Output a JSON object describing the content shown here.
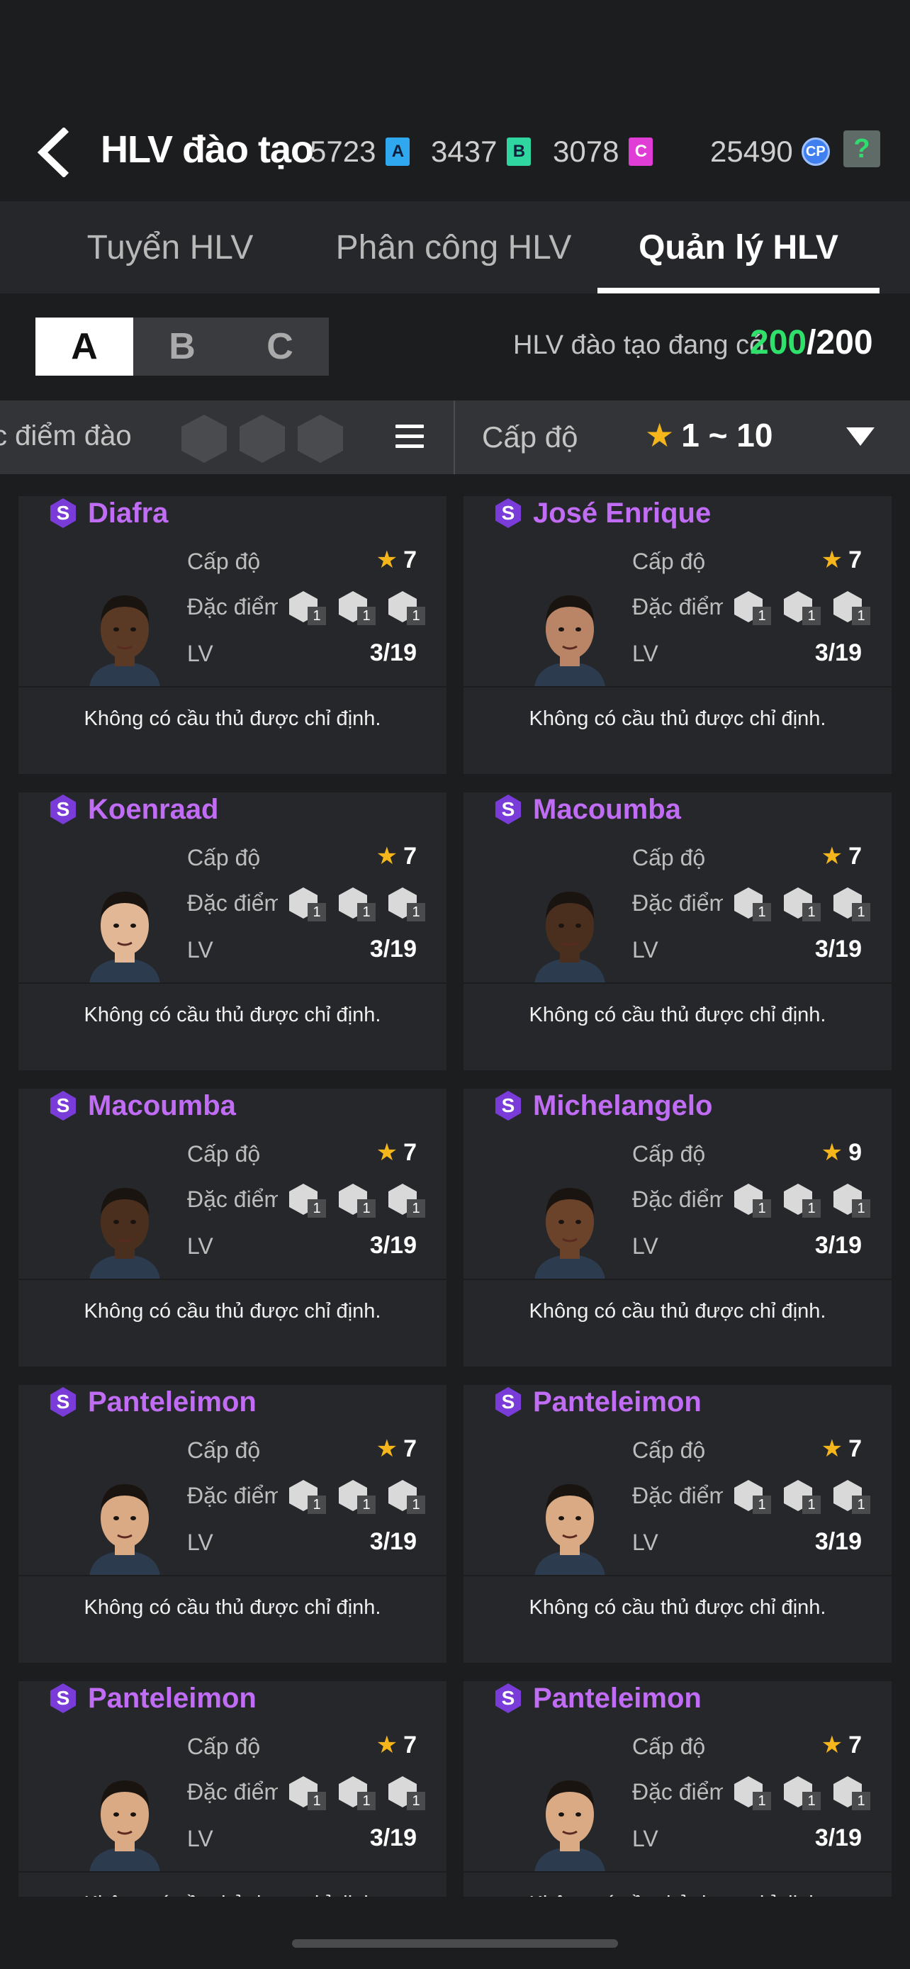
{
  "header": {
    "title": "HLV đào tạo",
    "currencies": [
      {
        "value": "5723",
        "badge": "A",
        "color": "#2fa8f0"
      },
      {
        "value": "3437",
        "badge": "B",
        "color": "#2fd6a0"
      },
      {
        "value": "3078",
        "badge": "C",
        "color": "#e03cd6"
      }
    ],
    "cp": {
      "value": "25490",
      "badge": "CP"
    },
    "help": "?"
  },
  "tabs": [
    {
      "label": "Tuyển HLV"
    },
    {
      "label": "Phân công  HLV"
    },
    {
      "label": "Quản lý HLV",
      "active": true
    }
  ],
  "segment": [
    "A",
    "B",
    "C"
  ],
  "count": {
    "label": "HLV đào tạo đang có",
    "current": "200",
    "max": "/200"
  },
  "filter": {
    "trait_label": "c điểm đào",
    "level_label": "Cấp độ",
    "level_range": "1 ~ 10"
  },
  "card_labels": {
    "level": "Cấp độ",
    "trait": "Đặc điểm",
    "lv": "LV",
    "status": "Không có cầu thủ được chỉ định."
  },
  "coaches": [
    {
      "name": "Diafra",
      "rating": "7",
      "lv": "3/19",
      "traits": [
        "1",
        "1",
        "1"
      ],
      "skin": "#5a3a24"
    },
    {
      "name": "José Enrique",
      "rating": "7",
      "lv": "3/19",
      "traits": [
        "1",
        "1",
        "1"
      ],
      "skin": "#b98566"
    },
    {
      "name": "Koenraad",
      "rating": "7",
      "lv": "3/19",
      "traits": [
        "1",
        "1",
        "1"
      ],
      "skin": "#e2b796"
    },
    {
      "name": "Macoumba",
      "rating": "7",
      "lv": "3/19",
      "traits": [
        "1",
        "1",
        "1"
      ],
      "skin": "#4a2f1e"
    },
    {
      "name": "Macoumba",
      "rating": "7",
      "lv": "3/19",
      "traits": [
        "1",
        "1",
        "1"
      ],
      "skin": "#4a2f1e"
    },
    {
      "name": "Michelangelo",
      "rating": "9",
      "lv": "3/19",
      "traits": [
        "1",
        "1",
        "1"
      ],
      "skin": "#6b432b"
    },
    {
      "name": "Panteleimon",
      "rating": "7",
      "lv": "3/19",
      "traits": [
        "1",
        "1",
        "1"
      ],
      "skin": "#d9aa84"
    },
    {
      "name": "Panteleimon",
      "rating": "7",
      "lv": "3/19",
      "traits": [
        "1",
        "1",
        "1"
      ],
      "skin": "#d9aa84"
    },
    {
      "name": "Panteleimon",
      "rating": "7",
      "lv": "3/19",
      "traits": [
        "1",
        "1",
        "1"
      ],
      "skin": "#d9aa84"
    },
    {
      "name": "Panteleimon",
      "rating": "7",
      "lv": "3/19",
      "traits": [
        "1",
        "1",
        "1"
      ],
      "skin": "#d9aa84"
    }
  ]
}
